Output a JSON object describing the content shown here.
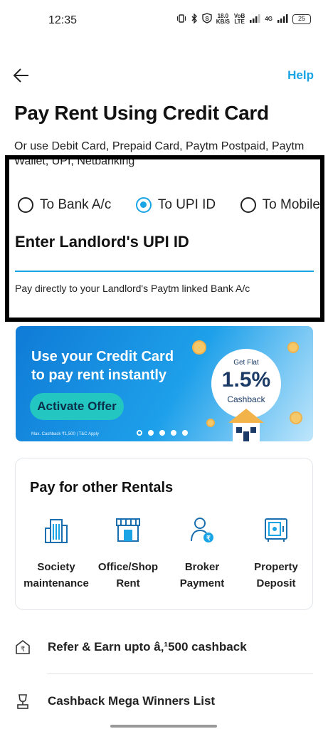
{
  "status_bar": {
    "time": "12:35",
    "network_speed": "18.0",
    "network_speed_unit": "KB/S",
    "volte_top": "VoB",
    "volte_bottom": "LTE",
    "signal_label": "4G",
    "battery": "25"
  },
  "header": {
    "back_icon": "arrow-left-icon",
    "help_label": "Help"
  },
  "page": {
    "title": "Pay Rent Using Credit Card",
    "subtitle": "Or use Debit Card, Prepaid Card, Paytm Postpaid, Paytm Wallet, UPI, Netbanking"
  },
  "payment_options": {
    "items": [
      {
        "label": "To Bank A/c",
        "selected": false
      },
      {
        "label": "To UPI ID",
        "selected": true
      },
      {
        "label": "To Mobile",
        "selected": false
      }
    ]
  },
  "upi": {
    "label": "Enter Landlord's UPI ID",
    "value": "",
    "placeholder": "",
    "hint": "Pay directly to your Landlord's Paytm linked Bank A/c"
  },
  "banner": {
    "line1": "Use your Credit Card",
    "line2": "to pay rent instantly",
    "button_label": "Activate Offer",
    "fine_print": "Max. Cashback ₹1,500 | T&C Apply",
    "cashback_top": "Get Flat",
    "cashback_value": "1.5%",
    "cashback_bottom": "Cashback",
    "slide_count": 5,
    "active_slide": 0
  },
  "rentals": {
    "title": "Pay for other Rentals",
    "items": [
      {
        "label_line1": "Society",
        "label_line2": "maintenance",
        "icon": "building-icon"
      },
      {
        "label_line1": "Office/Shop",
        "label_line2": "Rent",
        "icon": "shop-icon"
      },
      {
        "label_line1": "Broker",
        "label_line2": "Payment",
        "icon": "broker-icon"
      },
      {
        "label_line1": "Property",
        "label_line2": "Deposit",
        "icon": "safe-icon"
      }
    ]
  },
  "links": {
    "refer": {
      "label": "Refer & Earn upto â‚¹500 cashback",
      "icon": "rupee-house-icon"
    },
    "winners": {
      "label": "Cashback Mega Winners List",
      "icon": "trophy-icon"
    }
  },
  "colors": {
    "accent": "#19a4e6",
    "banner_button": "#23c6c0",
    "text": "#111111"
  }
}
